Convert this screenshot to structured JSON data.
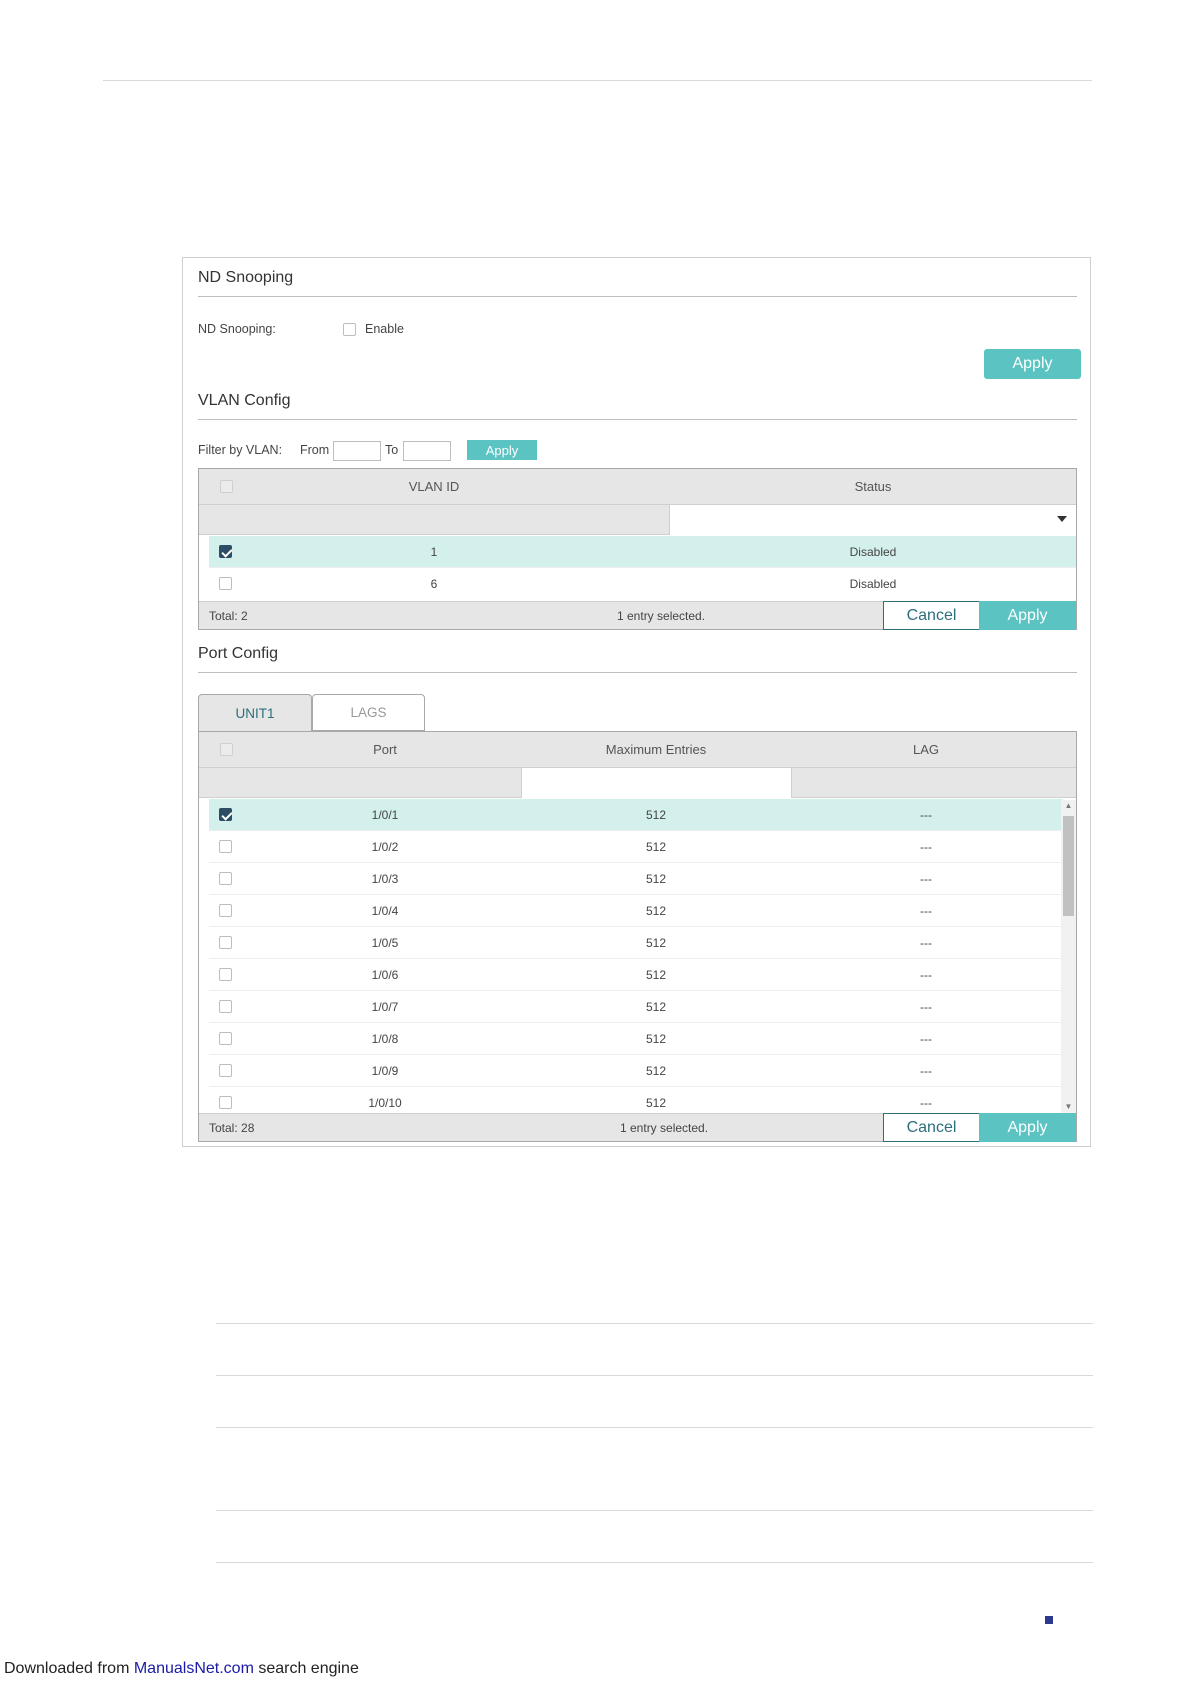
{
  "nd_snooping": {
    "title": "ND Snooping",
    "field_label": "ND Snooping:",
    "enable_label": "Enable",
    "enabled": false,
    "apply_label": "Apply"
  },
  "vlan_config": {
    "title": "VLAN Config",
    "filter_label": "Filter by VLAN:",
    "from_label": "From",
    "to_label": "To",
    "from_value": "",
    "to_value": "",
    "filter_apply_label": "Apply",
    "columns": [
      "VLAN ID",
      "Status"
    ],
    "rows": [
      {
        "vlan_id": "1",
        "status": "Disabled",
        "checked": true
      },
      {
        "vlan_id": "6",
        "status": "Disabled",
        "checked": false
      }
    ],
    "total": "Total: 2",
    "selected_text": "1 entry selected.",
    "cancel_label": "Cancel",
    "apply_label": "Apply"
  },
  "port_config": {
    "title": "Port Config",
    "tabs": [
      {
        "label": "UNIT1",
        "active": true
      },
      {
        "label": "LAGS",
        "active": false
      }
    ],
    "columns": [
      "Port",
      "Maximum Entries",
      "LAG"
    ],
    "rows": [
      {
        "port": "1/0/1",
        "max_entries": "512",
        "lag": "---",
        "checked": true
      },
      {
        "port": "1/0/2",
        "max_entries": "512",
        "lag": "---",
        "checked": false
      },
      {
        "port": "1/0/3",
        "max_entries": "512",
        "lag": "---",
        "checked": false
      },
      {
        "port": "1/0/4",
        "max_entries": "512",
        "lag": "---",
        "checked": false
      },
      {
        "port": "1/0/5",
        "max_entries": "512",
        "lag": "---",
        "checked": false
      },
      {
        "port": "1/0/6",
        "max_entries": "512",
        "lag": "---",
        "checked": false
      },
      {
        "port": "1/0/7",
        "max_entries": "512",
        "lag": "---",
        "checked": false
      },
      {
        "port": "1/0/8",
        "max_entries": "512",
        "lag": "---",
        "checked": false
      },
      {
        "port": "1/0/9",
        "max_entries": "512",
        "lag": "---",
        "checked": false
      },
      {
        "port": "1/0/10",
        "max_entries": "512",
        "lag": "---",
        "checked": false
      }
    ],
    "total": "Total: 28",
    "selected_text": "1 entry selected.",
    "cancel_label": "Cancel",
    "apply_label": "Apply"
  },
  "footer": {
    "prefix": "Downloaded from ",
    "link": "ManualsNet.com",
    "suffix": " search engine"
  },
  "colors": {
    "accent": "#5bc4c3",
    "dark_accent": "#2c6e7a",
    "selected_row": "#d4f0ec",
    "header_bg": "#e6e6e6"
  }
}
